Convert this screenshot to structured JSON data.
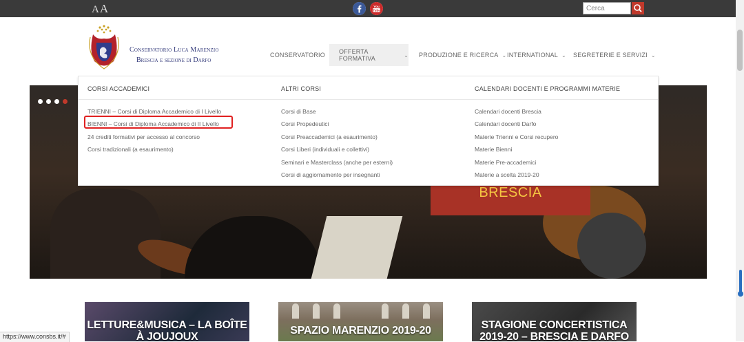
{
  "topbar": {
    "font_size_label": {
      "small": "A",
      "large": "A"
    },
    "social": [
      {
        "icon": "facebook-icon",
        "color": "#3b5998"
      },
      {
        "icon": "youtube-icon",
        "color": "#cc2b2b"
      }
    ],
    "search_placeholder": "Cerca",
    "search_button_color": "#c0392b"
  },
  "brand": {
    "line1": "Conservatorio Luca Marenzio",
    "line2": "Brescia e sezione di Darfo",
    "logo_ring_text": "CAELESTIS SPECIMEN CONCENTUS"
  },
  "nav": [
    {
      "label": "CONSERVATORIO",
      "active": false
    },
    {
      "label": "OFFERTA FORMATIVA",
      "active": true
    },
    {
      "label": "PRODUZIONE E RICERCA",
      "active": false
    },
    {
      "label": "INTERNATIONAL",
      "active": false
    },
    {
      "label": "SEGRETERIE E SERVIZI",
      "active": false
    }
  ],
  "mega_menu": {
    "columns": [
      {
        "title": "CORSI ACCADEMICI",
        "items": [
          "TRIENNI – Corsi di Diploma Accademico di I Livello",
          "BIENNI – Corsi di Diploma Accademico di II Livello",
          "24 crediti formativi per accesso al concorso",
          "Corsi tradizionali (a esaurimento)"
        ]
      },
      {
        "title": "ALTRI CORSI",
        "items": [
          "Corsi di Base",
          "Corsi Propedeutici",
          "Corsi Preaccademici (a esaurimento)",
          "Corsi Liberi (individuali e collettivi)",
          "Seminari e Masterclass (anche per esterni)",
          "Corsi di aggiornamento per insegnanti"
        ]
      },
      {
        "title": "CALENDARI DOCENTI E PROGRAMMI MATERIE",
        "items": [
          "Calendari docenti Brescia",
          "Calendari docenti Darfo",
          "Materie Trienni e Corsi recupero",
          "Materie Bienni",
          "Materie Pre-accademici",
          "Materie a scelta 2019-20"
        ]
      }
    ],
    "highlight_color": "#e02020"
  },
  "hero": {
    "caption": "BRESCIA",
    "caption_color": "#f5c542",
    "caption_bg": "#a83226",
    "slider_dots": 4,
    "active_dot": 4
  },
  "cards": [
    {
      "title": "LETTURE&MUSICA – LA BOÎTE À JOUJOUX"
    },
    {
      "title": "SPAZIO MARENZIO 2019-20"
    },
    {
      "title": "STAGIONE CONCERTISTICA 2019-20 – BRESCIA E DARFO"
    }
  ],
  "status_bar": "https://www.consbs.it/#"
}
